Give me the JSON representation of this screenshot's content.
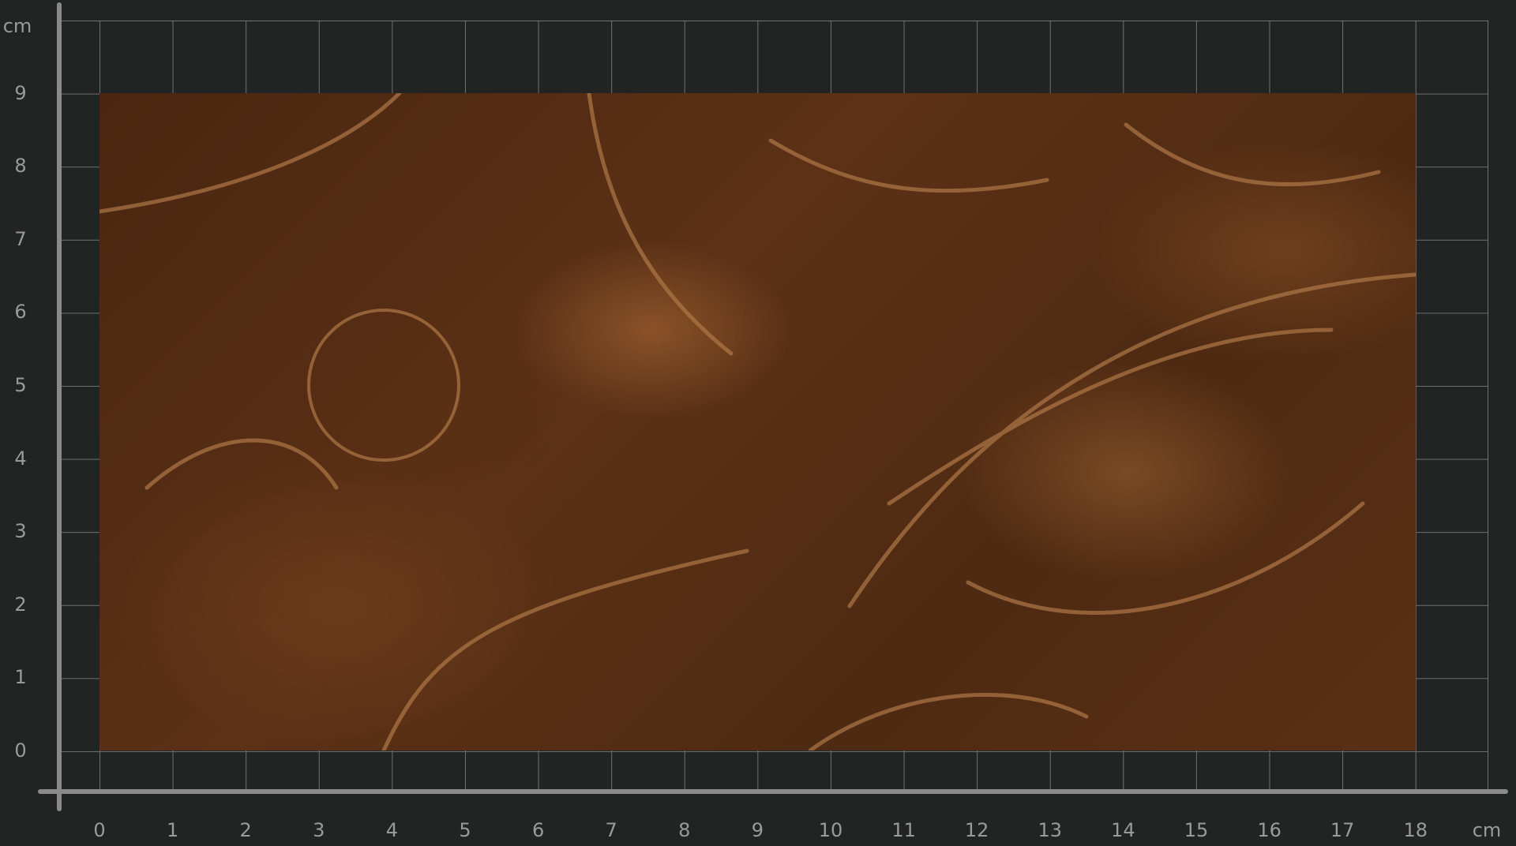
{
  "units": "cm",
  "y_ticks": [
    "0",
    "1",
    "2",
    "3",
    "4",
    "5",
    "6",
    "7",
    "8",
    "9"
  ],
  "x_ticks": [
    "0",
    "1",
    "2",
    "3",
    "4",
    "5",
    "6",
    "7",
    "8",
    "9",
    "10",
    "11",
    "12",
    "13",
    "14",
    "15",
    "16",
    "17",
    "18"
  ],
  "colors": {
    "background": "#222423",
    "axis": "#8a8a8a",
    "label": "#9a9a9a"
  }
}
